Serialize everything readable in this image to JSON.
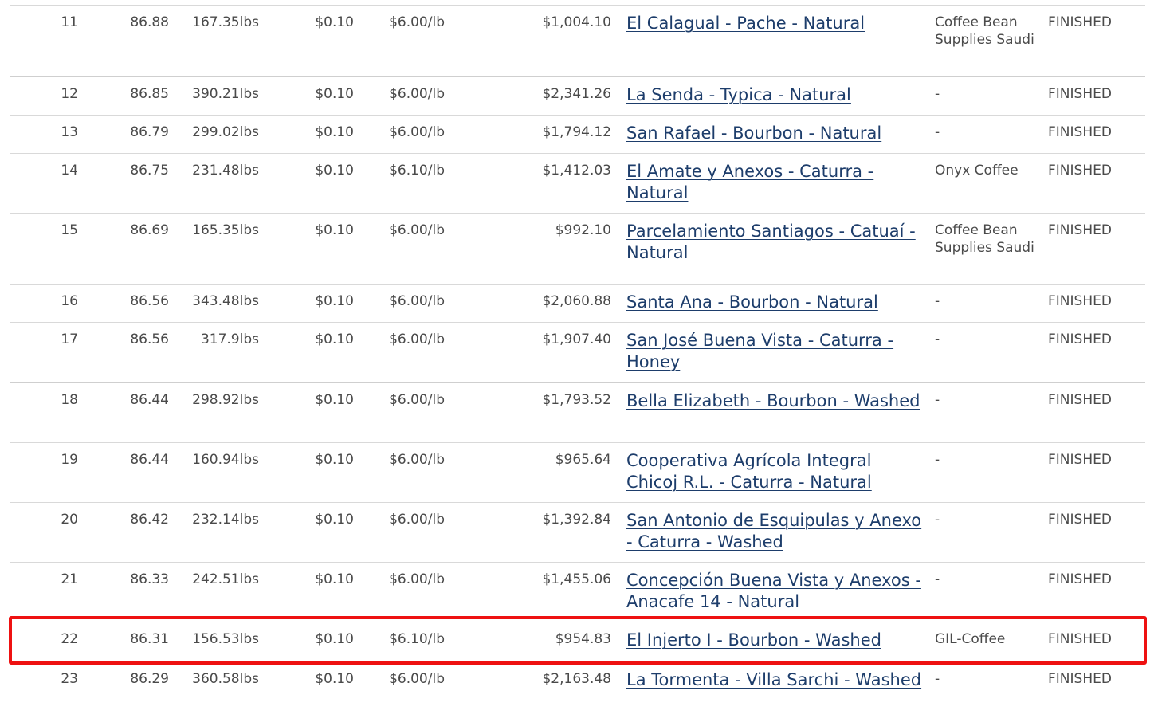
{
  "table": {
    "rows": [
      {
        "rank": "11",
        "score": "86.88",
        "weight": "167.35lbs",
        "bid": "$0.10",
        "price": "$6.00/lb",
        "total": "$1,004.10",
        "farm": "El Calagual - Pache - Natural",
        "buyer": "Coffee Bean Supplies Saudi",
        "status": "FINISHED"
      },
      {
        "rank": "12",
        "score": "86.85",
        "weight": "390.21lbs",
        "bid": "$0.10",
        "price": "$6.00/lb",
        "total": "$2,341.26",
        "farm": "La Senda - Typica - Natural",
        "buyer": "-",
        "status": "FINISHED"
      },
      {
        "rank": "13",
        "score": "86.79",
        "weight": "299.02lbs",
        "bid": "$0.10",
        "price": "$6.00/lb",
        "total": "$1,794.12",
        "farm": "San Rafael - Bourbon - Natural",
        "buyer": "-",
        "status": "FINISHED"
      },
      {
        "rank": "14",
        "score": "86.75",
        "weight": "231.48lbs",
        "bid": "$0.10",
        "price": "$6.10/lb",
        "total": "$1,412.03",
        "farm": "El Amate y Anexos - Caturra - Natural",
        "buyer": "Onyx Coffee",
        "status": "FINISHED"
      },
      {
        "rank": "15",
        "score": "86.69",
        "weight": "165.35lbs",
        "bid": "$0.10",
        "price": "$6.00/lb",
        "total": "$992.10",
        "farm": "Parcelamiento Santiagos - Catuaí - Natural",
        "buyer": "Coffee Bean Supplies Saudi",
        "status": "FINISHED"
      },
      {
        "rank": "16",
        "score": "86.56",
        "weight": "343.48lbs",
        "bid": "$0.10",
        "price": "$6.00/lb",
        "total": "$2,060.88",
        "farm": "Santa Ana - Bourbon - Natural",
        "buyer": "-",
        "status": "FINISHED"
      },
      {
        "rank": "17",
        "score": "86.56",
        "weight": "317.9lbs",
        "bid": "$0.10",
        "price": "$6.00/lb",
        "total": "$1,907.40",
        "farm": "San José Buena Vista - Caturra - Honey",
        "buyer": "-",
        "status": "FINISHED"
      },
      {
        "rank": "18",
        "score": "86.44",
        "weight": "298.92lbs",
        "bid": "$0.10",
        "price": "$6.00/lb",
        "total": "$1,793.52",
        "farm": "Bella Elizabeth - Bourbon - Washed",
        "buyer": "-",
        "status": "FINISHED"
      },
      {
        "rank": "19",
        "score": "86.44",
        "weight": "160.94lbs",
        "bid": "$0.10",
        "price": "$6.00/lb",
        "total": "$965.64",
        "farm": "Cooperativa Agrícola Integral Chicoj R.L. - Caturra - Natural",
        "buyer": "-",
        "status": "FINISHED"
      },
      {
        "rank": "20",
        "score": "86.42",
        "weight": "232.14lbs",
        "bid": "$0.10",
        "price": "$6.00/lb",
        "total": "$1,392.84",
        "farm": "San Antonio de Esquipulas y Anexo - Caturra - Washed",
        "buyer": "-",
        "status": "FINISHED"
      },
      {
        "rank": "21",
        "score": "86.33",
        "weight": "242.51lbs",
        "bid": "$0.10",
        "price": "$6.00/lb",
        "total": "$1,455.06",
        "farm": "Concepción Buena Vista y Anexos - Anacafe 14 - Natural",
        "buyer": "-",
        "status": "FINISHED"
      },
      {
        "rank": "22",
        "score": "86.31",
        "weight": "156.53lbs",
        "bid": "$0.10",
        "price": "$6.10/lb",
        "total": "$954.83",
        "farm": "El Injerto I - Bourbon - Washed",
        "buyer": "GIL-Coffee",
        "status": "FINISHED"
      },
      {
        "rank": "23",
        "score": "86.29",
        "weight": "360.58lbs",
        "bid": "$0.10",
        "price": "$6.00/lb",
        "total": "$2,163.48",
        "farm": "La Tormenta - Villa Sarchi - Washed",
        "buyer": "-",
        "status": "FINISHED"
      }
    ]
  },
  "colors": {
    "text": "#4a4a4a",
    "link": "#1d3d6b",
    "row_border": "#d9d9d9",
    "highlight": "#ee1111"
  }
}
